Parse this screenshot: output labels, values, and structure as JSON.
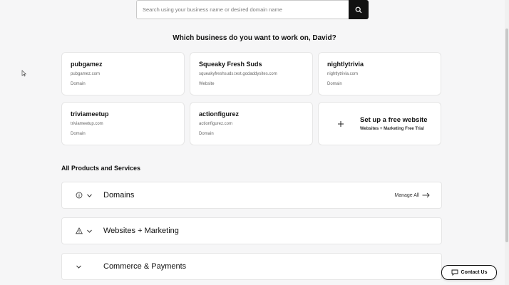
{
  "search": {
    "placeholder": "Search using your business name or desired domain name",
    "icon": "search-icon"
  },
  "heading": "Which business do you want to work on, David?",
  "businesses": [
    {
      "name": "pubgamez",
      "url": "pubgamez.com",
      "type": "Domain"
    },
    {
      "name": "Squeaky Fresh Suds",
      "url": "squeakyfreshsuds.test.godaddysites.com",
      "type": "Website"
    },
    {
      "name": "nightlytrivia",
      "url": "nightlytrivia.com",
      "type": "Domain"
    },
    {
      "name": "triviameetup",
      "url": "triviameetup.com",
      "type": "Domain"
    },
    {
      "name": "actionfigurez",
      "url": "actionfigurez.com",
      "type": "Domain"
    }
  ],
  "cta": {
    "title": "Set up a free website",
    "subtitle": "Websites + Marketing Free Trial",
    "icon": "plus-icon"
  },
  "section": {
    "title": "All Products and Services",
    "items": [
      {
        "title": "Domains",
        "icon": "info-icon",
        "action": "Manage All"
      },
      {
        "title": "Websites + Marketing",
        "icon": "warning-icon"
      },
      {
        "title": "Commerce & Payments"
      }
    ]
  },
  "contact": {
    "label": "Contact Us",
    "icon": "chat-icon"
  },
  "colors": {
    "background": "#f6f6f7",
    "accent": "#111111",
    "card": "#ffffff"
  }
}
